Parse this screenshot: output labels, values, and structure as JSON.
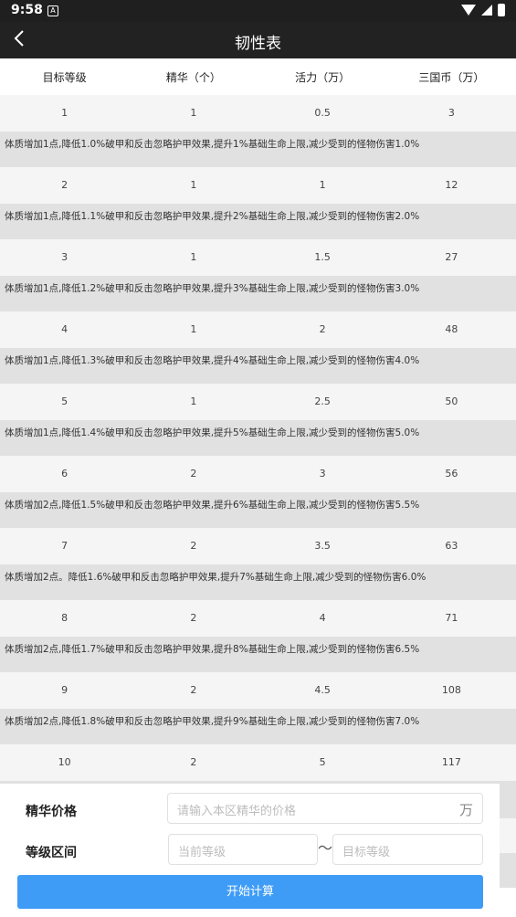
{
  "status_bar": {
    "time": "9:58",
    "notification_glyph": "A"
  },
  "app_bar": {
    "title": "韧性表"
  },
  "table": {
    "headers": [
      "目标等级",
      "精华（个）",
      "活力（万）",
      "三国币（万）"
    ],
    "rows": [
      {
        "level": "1",
        "essence": "1",
        "vitality": "0.5",
        "coins": "3",
        "desc": "体质增加1点,降低1.0%破甲和反击忽略护甲效果,提升1%基础生命上限,减少受到的怪物伤害1.0%"
      },
      {
        "level": "2",
        "essence": "1",
        "vitality": "1",
        "coins": "12",
        "desc": "体质增加1点,降低1.1%破甲和反击忽略护甲效果,提升2%基础生命上限,减少受到的怪物伤害2.0%"
      },
      {
        "level": "3",
        "essence": "1",
        "vitality": "1.5",
        "coins": "27",
        "desc": "体质增加1点,降低1.2%破甲和反击忽略护甲效果,提升3%基础生命上限,减少受到的怪物伤害3.0%"
      },
      {
        "level": "4",
        "essence": "1",
        "vitality": "2",
        "coins": "48",
        "desc": "体质增加1点,降低1.3%破甲和反击忽略护甲效果,提升4%基础生命上限,减少受到的怪物伤害4.0%"
      },
      {
        "level": "5",
        "essence": "1",
        "vitality": "2.5",
        "coins": "50",
        "desc": "体质增加1点,降低1.4%破甲和反击忽略护甲效果,提升5%基础生命上限,减少受到的怪物伤害5.0%"
      },
      {
        "level": "6",
        "essence": "2",
        "vitality": "3",
        "coins": "56",
        "desc": "体质增加2点,降低1.5%破甲和反击忽略护甲效果,提升6%基础生命上限,减少受到的怪物伤害5.5%"
      },
      {
        "level": "7",
        "essence": "2",
        "vitality": "3.5",
        "coins": "63",
        "desc": "体质增加2点。降低1.6%破甲和反击忽略护甲效果,提升7%基础生命上限,减少受到的怪物伤害6.0%"
      },
      {
        "level": "8",
        "essence": "2",
        "vitality": "4",
        "coins": "71",
        "desc": "体质增加2点,降低1.7%破甲和反击忽略护甲效果,提升8%基础生命上限,减少受到的怪物伤害6.5%"
      },
      {
        "level": "9",
        "essence": "2",
        "vitality": "4.5",
        "coins": "108",
        "desc": "体质增加2点,降低1.8%破甲和反击忽略护甲效果,提升9%基础生命上限,减少受到的怪物伤害7.0%"
      },
      {
        "level": "10",
        "essence": "2",
        "vitality": "5",
        "coins": "117",
        "desc": ""
      }
    ]
  },
  "form": {
    "essence_price_label": "精华价格",
    "essence_price_placeholder": "请输入本区精华的价格",
    "essence_price_unit": "万",
    "level_range_label": "等级区间",
    "range_separator": "〜",
    "current_level_placeholder": "当前等级",
    "target_level_placeholder": "目标等级",
    "calculate_button": "开始计算"
  },
  "colors": {
    "accent": "#3f9cf6",
    "app_bar": "#222222",
    "row_bg": "#f5f5f5",
    "desc_bg": "#e1e1e1"
  }
}
